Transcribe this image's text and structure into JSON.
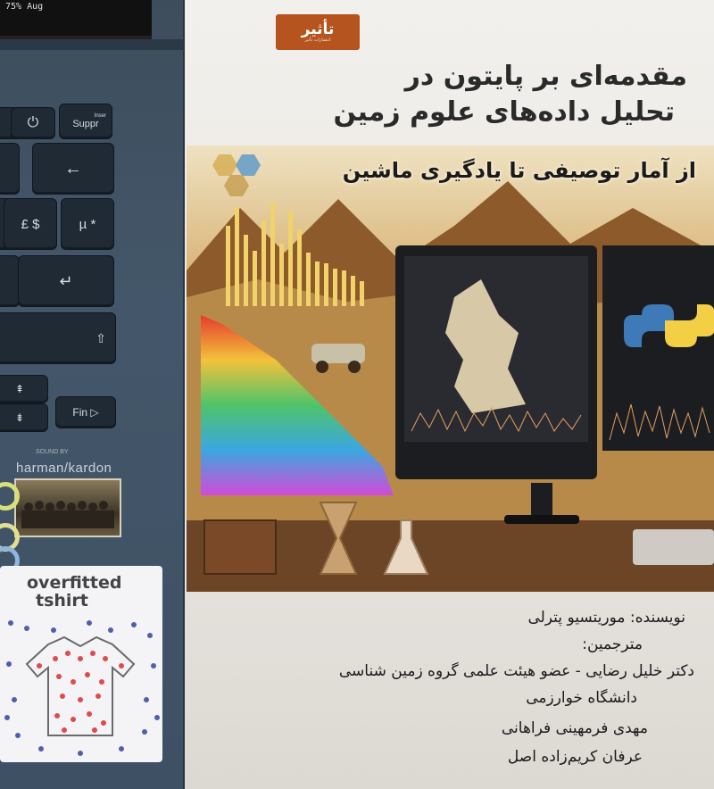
{
  "laptop": {
    "status_text": "75%      Aug",
    "keys": {
      "power_key": "⏻",
      "suppr_key": "Suppr",
      "suppr_sub": "Inser",
      "backspace_key": "←",
      "pound_dollar_key": "£ $",
      "mu_star_key": "µ *",
      "enter_key": "↵",
      "shift_key": "⇧",
      "page_up_key": "⇞",
      "page_down_key": "⇟",
      "fin_key": "Fin ▷"
    },
    "brand_sub": "SOUND BY",
    "brand": "harman/kardon",
    "sticker": {
      "line1": "overfitted",
      "line2": "tshirt"
    }
  },
  "book": {
    "publisher_logo": "تأثیر",
    "publisher_logo_sub": "انتشارات تأثیر",
    "title_line1": "مقدمه‌ای بر پایتون در",
    "title_line2": "تحلیل داده‌های علوم زمین",
    "subtitle": "از آمار توصیفی تا یادگیری ماشین",
    "credits": [
      "نویسنده:  موریتسیو پترلی",
      "مترجمین:",
      "دکتر خلیل رضایی - عضو هیئت علمی گروه زمین شناسی",
      "دانشگاه خوارزمی",
      "مهدی فرمهینی فراهانی",
      "عرفان کریم‌زاده اصل"
    ],
    "colors": {
      "logo": "#b5541e",
      "title": "#2a2a2a"
    }
  }
}
